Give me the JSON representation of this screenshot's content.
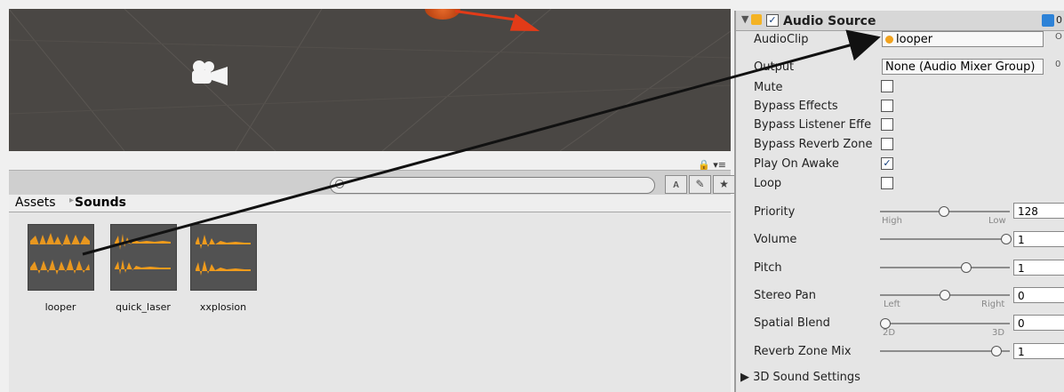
{
  "breadcrumb": {
    "root": "Assets",
    "separator": "▸",
    "current": "Sounds"
  },
  "assets": [
    {
      "name": "looper",
      "color": "#f09b1c"
    },
    {
      "name": "quick_laser",
      "color": "#f09b1c"
    },
    {
      "name": "xxplosion",
      "color": "#f09b1c"
    }
  ],
  "toolbar": {
    "search_placeholder": "",
    "buttons": [
      "ᴀ",
      "✎",
      "★"
    ]
  },
  "scene": {
    "lock_text": "🔒 ▾≡"
  },
  "inspector": {
    "title": "Audio Source",
    "right_indicator": "0",
    "audio_clip_label": "AudioClip",
    "audio_clip_value": "looper",
    "output_label": "Output",
    "output_value": "None (Audio Mixer Group)",
    "output_suffix": "0",
    "mute_label": "Mute",
    "bypass_effects_label": "Bypass Effects",
    "bypass_listener_label": "Bypass Listener Effe",
    "bypass_reverb_label": "Bypass Reverb Zone",
    "play_on_awake_label": "Play On Awake",
    "loop_label": "Loop",
    "priority_label": "Priority",
    "priority_value": "128",
    "priority_high": "High",
    "priority_low": "Low",
    "volume_label": "Volume",
    "volume_value": "1",
    "pitch_label": "Pitch",
    "pitch_value": "1",
    "stereo_pan_label": "Stereo Pan",
    "stereo_pan_value": "0",
    "stereo_left": "Left",
    "stereo_right": "Right",
    "spatial_blend_label": "Spatial Blend",
    "spatial_blend_value": "0",
    "spatial_2d": "2D",
    "spatial_3d": "3D",
    "reverb_zone_mix_label": "Reverb Zone Mix",
    "reverb_zone_mix_value": "1",
    "sound_settings_label": "3D Sound Settings"
  },
  "colors": {
    "accent_orange": "#f09b1c",
    "scene_bg": "#4a4744",
    "inspector_bg": "#e5e5e5"
  }
}
